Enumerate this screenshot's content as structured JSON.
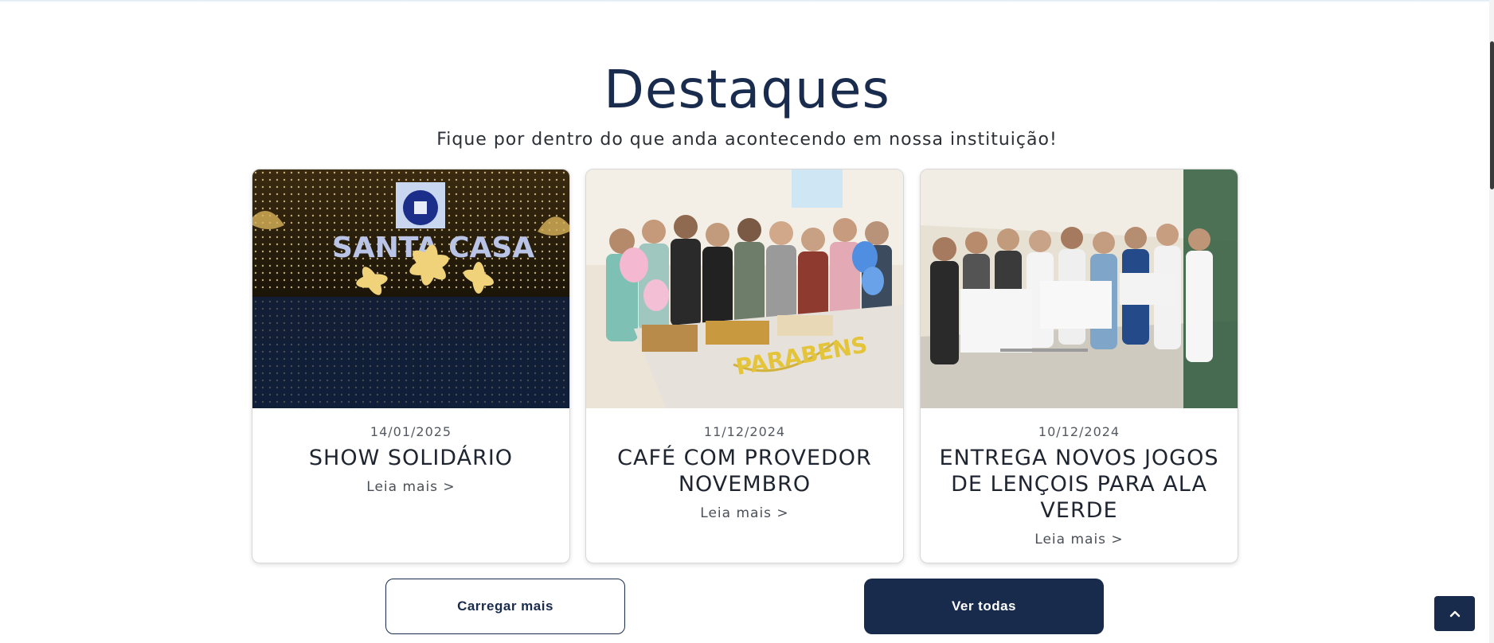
{
  "section": {
    "title": "Destaques",
    "subtitle": "Fique por dentro do que anda acontecendo em nossa instituição!"
  },
  "cards": [
    {
      "date": "14/01/2025",
      "title": "SHOW SOLIDÁRIO",
      "link_label": "Leia mais >",
      "image_text": "SANTA CASA"
    },
    {
      "date": "11/12/2024",
      "title": "CAFÉ COM PROVEDOR NOVEMBRO",
      "link_label": "Leia mais >",
      "image_text": "PARABENS"
    },
    {
      "date": "10/12/2024",
      "title": "ENTREGA NOVOS JOGOS DE LENÇOIS PARA ALA VERDE",
      "link_label": "Leia mais >"
    }
  ],
  "buttons": {
    "load_more": "Carregar mais",
    "view_all": "Ver todas"
  },
  "icons": {
    "back_to_top": "chevron-up-icon"
  },
  "colors": {
    "brand_navy": "#182b4d",
    "heading": "#1a2c4e"
  }
}
